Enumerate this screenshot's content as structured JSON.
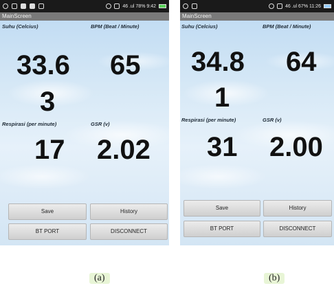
{
  "screens": [
    {
      "status": {
        "right_text": "46 .ul 78% 9:42"
      },
      "title": "MainScreen",
      "labels": {
        "suhu": "Suhu (Celcius)",
        "bpm": "BPM (Beat / Minute)",
        "respirasi": "Respirasi (per minute)",
        "gsr": "GSR (v)"
      },
      "values": {
        "suhu_line1": "33.6",
        "suhu_line2": "3",
        "bpm": "65",
        "respirasi": "17",
        "gsr": "2.02"
      },
      "buttons": {
        "save": "Save",
        "history": "History",
        "bt_port": "BT PORT",
        "disconnect": "DISCONNECT"
      },
      "caption": "(a)"
    },
    {
      "status": {
        "right_text": "46 .ul 67% 11:26"
      },
      "title": "MainScreen",
      "labels": {
        "suhu": "Suhu (Celcius)",
        "bpm": "BPM (Beat / Minute)",
        "respirasi": "Respirasi (per minute)",
        "gsr": "GSR (v)"
      },
      "values": {
        "suhu_line1": "34.8",
        "suhu_line2": "1",
        "bpm": "64",
        "respirasi": "31",
        "gsr": "2.00"
      },
      "buttons": {
        "save": "Save",
        "history": "History",
        "bt_port": "BT PORT",
        "disconnect": "DISCONNECT"
      },
      "caption": "(b)"
    }
  ]
}
